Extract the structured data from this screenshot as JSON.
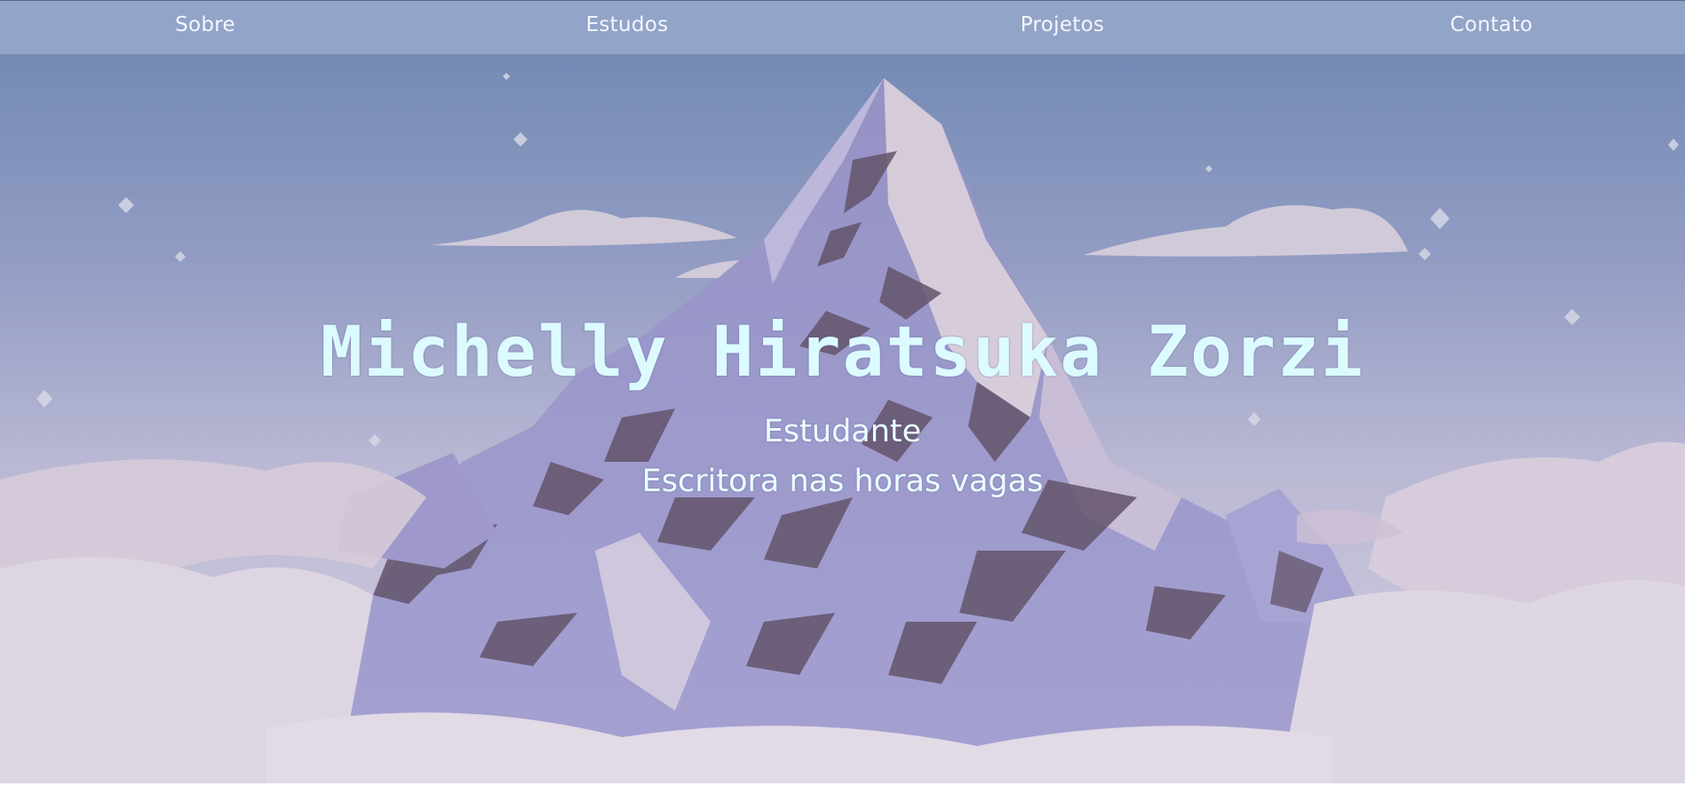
{
  "nav": {
    "items": [
      {
        "label": "Sobre"
      },
      {
        "label": "Estudos"
      },
      {
        "label": "Projetos"
      },
      {
        "label": "Contato"
      }
    ]
  },
  "hero": {
    "name": "Michelly Hiratsuka Zorzi",
    "role": "Estudante",
    "hobby": "Escritora nas horas vagas",
    "background_icon": "mountain-illustration"
  },
  "colors": {
    "nav_background": "#94a6c8",
    "nav_text": "#f4f6ff",
    "title_text": "#dcfbff",
    "subtitle_text": "#eaffff",
    "sky_top": "#5a78a8",
    "sky_bottom": "#c9c3d8"
  }
}
